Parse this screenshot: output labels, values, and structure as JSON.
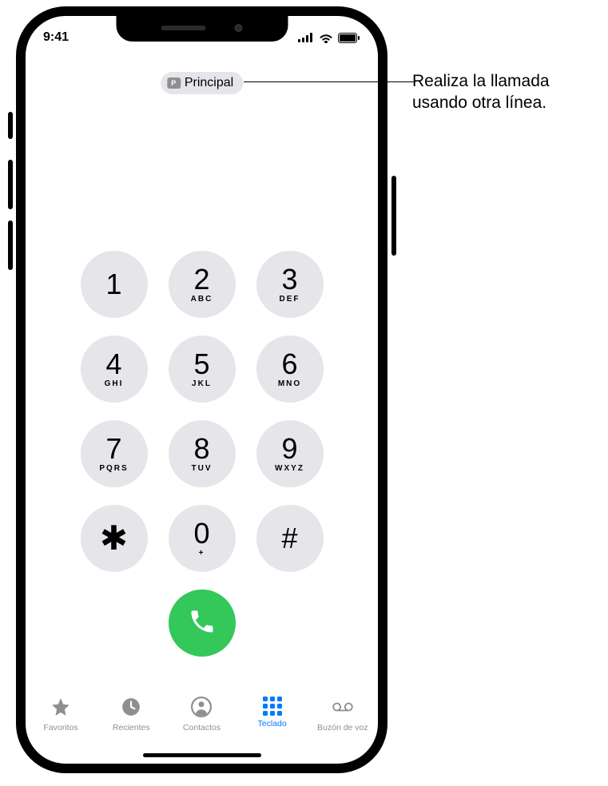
{
  "status": {
    "time": "9:41"
  },
  "line_selector": {
    "badge": "P",
    "label": "Principal"
  },
  "keypad": {
    "keys": [
      {
        "digit": "1",
        "letters": ""
      },
      {
        "digit": "2",
        "letters": "ABC"
      },
      {
        "digit": "3",
        "letters": "DEF"
      },
      {
        "digit": "4",
        "letters": "GHI"
      },
      {
        "digit": "5",
        "letters": "JKL"
      },
      {
        "digit": "6",
        "letters": "MNO"
      },
      {
        "digit": "7",
        "letters": "PQRS"
      },
      {
        "digit": "8",
        "letters": "TUV"
      },
      {
        "digit": "9",
        "letters": "WXYZ"
      },
      {
        "digit": "✱",
        "letters": ""
      },
      {
        "digit": "0",
        "letters": "+"
      },
      {
        "digit": "#",
        "letters": ""
      }
    ]
  },
  "tabs": {
    "favorites": "Favoritos",
    "recents": "Recientes",
    "contacts": "Contactos",
    "keypad": "Teclado",
    "voicemail": "Buzón de voz"
  },
  "callout": {
    "text": "Realiza la llamada usando otra línea."
  }
}
